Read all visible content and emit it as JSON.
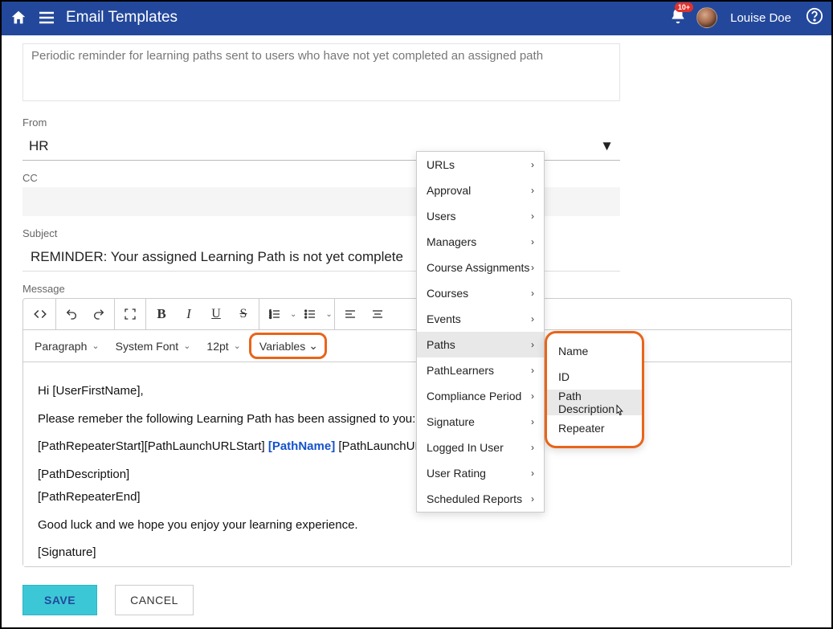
{
  "header": {
    "title": "Email Templates",
    "badge": "10+",
    "username": "Louise Doe"
  },
  "form": {
    "description_value": "Periodic reminder for learning paths sent to users who have not yet completed an assigned path",
    "from_label": "From",
    "from_value": "HR",
    "cc_label": "CC",
    "cc_value": "",
    "subject_label": "Subject",
    "subject_value": "REMINDER: Your assigned Learning Path is not yet complete",
    "message_label": "Message"
  },
  "toolbar": {
    "paragraph": "Paragraph",
    "font": "System Font",
    "size": "12pt",
    "variables": "Variables"
  },
  "body": {
    "line1": "Hi [UserFirstName],",
    "line2": "Please remeber the following Learning Path has been assigned to you:",
    "line3a": "[PathRepeaterStart][PathLaunchURLStart] ",
    "line3b": "[PathName]",
    "line3c": " [PathLaunchURLEnd]",
    "line4": "[PathDescription]",
    "line5": "[PathRepeaterEnd]",
    "line6": "Good luck and we hope you enjoy your learning experience.",
    "line7": "[Signature]"
  },
  "buttons": {
    "save": "SAVE",
    "cancel": "CANCEL"
  },
  "menu1": [
    "URLs",
    "Approval",
    "Users",
    "Managers",
    "Course Assignments",
    "Courses",
    "Events",
    "Paths",
    "PathLearners",
    "Compliance Period",
    "Signature",
    "Logged In User",
    "User Rating",
    "Scheduled Reports"
  ],
  "menu1_hover_index": 7,
  "menu2": [
    "Name",
    "ID",
    "Path Description",
    "Repeater"
  ],
  "menu2_hover_index": 2
}
